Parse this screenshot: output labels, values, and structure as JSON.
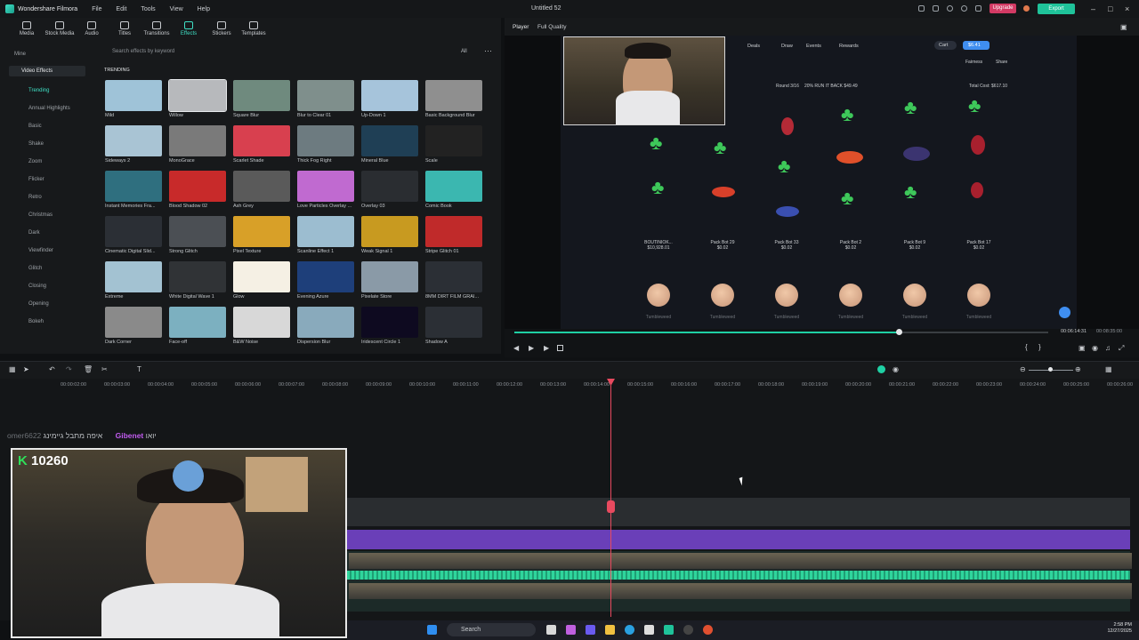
{
  "app": {
    "name": "Wondershare Filmora",
    "project_title": "Untitled 52",
    "upgrade_label": "Upgrade",
    "export_label": "Export"
  },
  "menu": [
    "File",
    "Edit",
    "Tools",
    "View",
    "Help"
  ],
  "media_tabs": [
    {
      "label": "Media",
      "icon": "media-icon"
    },
    {
      "label": "Stock Media",
      "icon": "stock-media-icon"
    },
    {
      "label": "Audio",
      "icon": "music-note-icon"
    },
    {
      "label": "Titles",
      "icon": "text-icon"
    },
    {
      "label": "Transitions",
      "icon": "transitions-icon"
    },
    {
      "label": "Effects",
      "icon": "effects-icon",
      "active": true
    },
    {
      "label": "Stickers",
      "icon": "sticker-icon"
    },
    {
      "label": "Templates",
      "icon": "templates-icon"
    }
  ],
  "sidebar": {
    "mine": "Mine",
    "section": "Video Effects",
    "items": [
      "Trending",
      "Annual Highlights",
      "Basic",
      "Shake",
      "Zoom",
      "Flicker",
      "Retro",
      "Christmas",
      "Dark",
      "Viewfinder",
      "Glitch",
      "Closing",
      "Opening",
      "Bokeh"
    ]
  },
  "effects": {
    "search_placeholder": "Search effects by keyword",
    "filter": "All",
    "section_label": "TRENDING",
    "items": [
      "Mild",
      "Willow",
      "Square Blur",
      "Blur to Clear 01",
      "Up-Down 1",
      "Basic Background Blur",
      "Sideways 2",
      "MonoGrace",
      "Scarlet Shade",
      "Thick Fog Right",
      "Mineral Blue",
      "Scale",
      "Instant Memories Fra...",
      "Blood Shadow 02",
      "Ash Grey",
      "Love Particles Overlay ...",
      "Overlay 03",
      "Comic Book",
      "Cinematic Digital Slid...",
      "Strong Glitch",
      "Pixel Texture",
      "Scanline Effect 1",
      "Weak Signal 1",
      "Stripe Glitch 01",
      "Extreme",
      "White Digital Wave 1",
      "Glow",
      "Evening Azure",
      "Pixelate Store",
      "8MM DIRT FILM GRAI...",
      "Dark Corner",
      "Face-off",
      "B&W Noise",
      "Dispersion Blur",
      "Iridescent Circle 1",
      "Shadow A"
    ],
    "colors": [
      "#9fc3d8",
      "#b7b9bc",
      "#6f8a7e",
      "#7f8f8c",
      "#a6c4db",
      "#8f8f8f",
      "#a9c4d4",
      "#7a7a7a",
      "#d8404f",
      "#6d7b80",
      "#1f3f55",
      "#222",
      "#2f6f7f",
      "#c82a2a",
      "#5a5a5a",
      "#c06ad0",
      "#2a2d31",
      "#3bb7b0",
      "#2b2f35",
      "#4b4f54",
      "#d8a028",
      "#9cbdd0",
      "#c89a20",
      "#c02a2a",
      "#a3c2d2",
      "#303336",
      "#f5f0e4",
      "#1e3f7a",
      "#8a9aa7",
      "#2b2f35",
      "#8a8a8a",
      "#7cb0c0",
      "#d8d8d8",
      "#89aabc",
      "#0e0a20",
      "#2b2f35"
    ]
  },
  "player": {
    "label": "Player",
    "quality": "Full Quality",
    "current_time": "00:06:14:31",
    "total_time": "00:08:35:00",
    "progress": 0.72
  },
  "game": {
    "nav": [
      "Deals",
      "Draw",
      "Events",
      "Rewards"
    ],
    "cart": "Cart",
    "balance": "$6.41",
    "fairness": "Fairness",
    "share": "Share",
    "round": "Round 3/16",
    "round_info": "20% RUN IT BACK $49.49",
    "total_cost": "Total Cost: $617.10",
    "players": [
      {
        "name": "BOUTINIOK...",
        "value": "$10,928.01"
      },
      {
        "name": "Pack Bot 29",
        "value": "$0.02"
      },
      {
        "name": "Pack Bot 33",
        "value": "$0.02"
      },
      {
        "name": "Pack Bot 2",
        "value": "$0.02"
      },
      {
        "name": "Pack Bot 9",
        "value": "$0.02"
      },
      {
        "name": "Pack Bot 17",
        "value": "$0.02"
      }
    ],
    "coin_label": "Tumbleweed"
  },
  "timeline": {
    "ruler": [
      "00:00:02:00",
      "00:00:03:00",
      "00:00:04:00",
      "00:00:05:00",
      "00:00:06:00",
      "00:00:07:00",
      "00:00:08:00",
      "00:00:09:00",
      "00:00:10:00",
      "00:00:11:00",
      "00:00:12:00",
      "00:00:13:00",
      "00:00:14:00",
      "00:00:15:00",
      "00:00:16:00",
      "00:00:17:00",
      "00:00:18:00",
      "00:00:19:00",
      "00:00:20:00",
      "00:00:21:00",
      "00:00:22:00",
      "00:00:23:00",
      "00:00:24:00",
      "00:00:25:00",
      "00:00:26:00"
    ]
  },
  "stream": {
    "points": "10260",
    "chat_user_a": "omer6622",
    "chat_text_a": "איפה מתבל גיימינג",
    "chat_user_b": "Gibenet",
    "chat_text_b": "יואו"
  },
  "taskbar": {
    "search": "Search",
    "time": "2:58 PM",
    "date": "12/27/2025"
  }
}
